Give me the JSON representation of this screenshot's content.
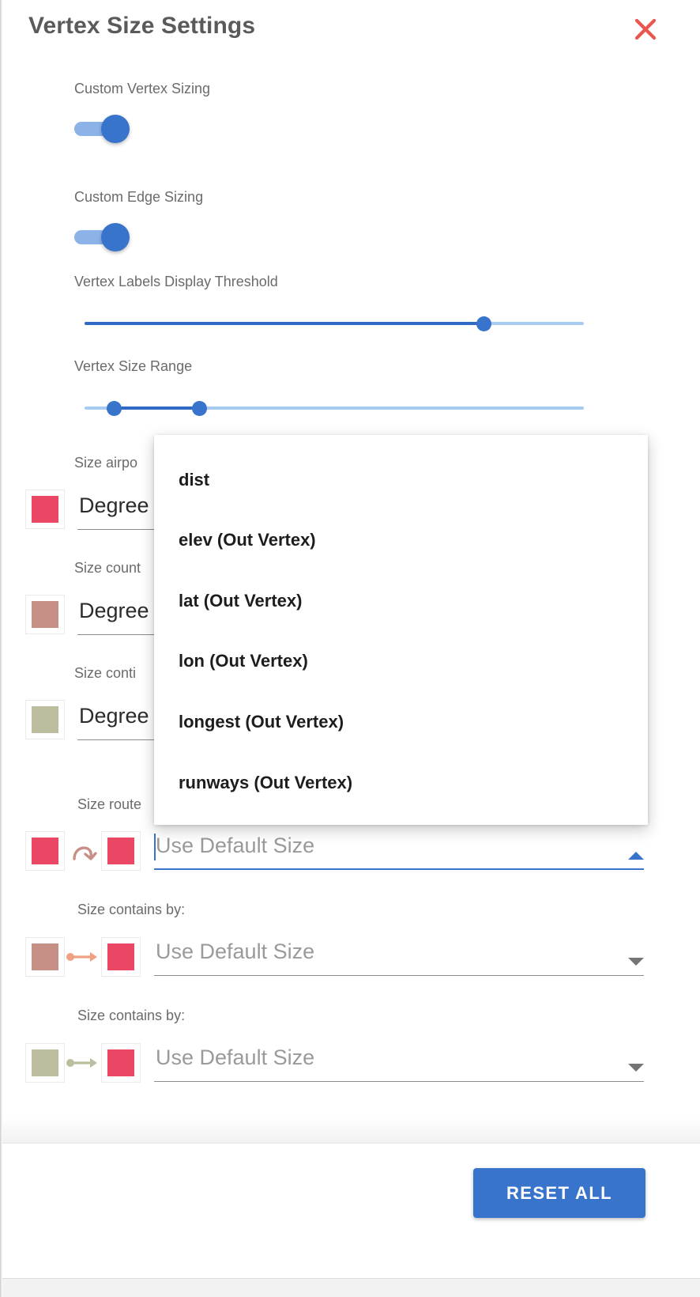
{
  "header": {
    "title": "Vertex Size Settings",
    "close_icon": "close-icon"
  },
  "controls": {
    "custom_vertex_sizing": {
      "label": "Custom Vertex Sizing",
      "state": "on"
    },
    "custom_edge_sizing": {
      "label": "Custom Edge Sizing",
      "state": "on"
    },
    "vertex_labels_threshold": {
      "label": "Vertex Labels Display Threshold",
      "value_pct": 80
    },
    "vertex_size_range": {
      "label": "Vertex Size Range",
      "low_pct": 6,
      "high_pct": 23
    }
  },
  "vertex_rows": [
    {
      "label": "Size airpo",
      "value": "Degree",
      "color": "#ec4665"
    },
    {
      "label": "Size count",
      "value": "Degree",
      "color": "#c79086"
    },
    {
      "label": "Size conti",
      "value": "Degree",
      "color": "#bcbc9e"
    }
  ],
  "edge_rows": [
    {
      "label": "Size route",
      "value": "Use Default Size",
      "placeholder": "Use Default Size",
      "source_color": "#ec4665",
      "target_color": "#ec4665",
      "arrow_color": "#c79086",
      "arrow_icon": "loop-arrow-icon",
      "caret_icon": "chevron-up-icon",
      "active": true
    },
    {
      "label": "Size contains by:",
      "value": "Use Default Size",
      "placeholder": "Use Default Size",
      "source_color": "#c79086",
      "target_color": "#ec4665",
      "arrow_color": "#f0a183",
      "arrow_icon": "arrow-right-icon",
      "caret_icon": "chevron-down-icon",
      "active": false
    },
    {
      "label": "Size contains by:",
      "value": "Use Default Size",
      "placeholder": "Use Default Size",
      "source_color": "#bcbc9e",
      "target_color": "#ec4665",
      "arrow_color": "#bcbc9e",
      "arrow_icon": "arrow-right-icon",
      "caret_icon": "chevron-down-icon",
      "active": false
    }
  ],
  "dropdown": {
    "options": [
      {
        "label": "dist"
      },
      {
        "label": "elev (Out Vertex)"
      },
      {
        "label": "lat (Out Vertex)"
      },
      {
        "label": "lon (Out Vertex)"
      },
      {
        "label": "longest (Out Vertex)"
      },
      {
        "label": "runways (Out Vertex)"
      }
    ]
  },
  "footer": {
    "reset_label": "RESET ALL"
  },
  "colors": {
    "accent_blue": "#3874cb",
    "rail_blue": "#a8cbf2",
    "close_red": "#e8564e",
    "label_gray": "#6b6b6b",
    "placeholder_gray": "#9a9a9a"
  }
}
